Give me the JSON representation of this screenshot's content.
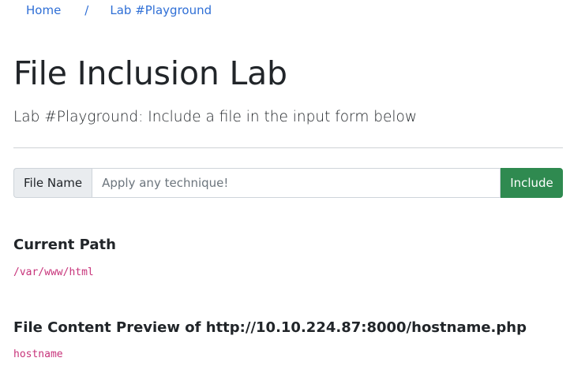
{
  "breadcrumb": {
    "home": "Home",
    "separator": "/",
    "current": "Lab #Playground"
  },
  "page": {
    "title": "File Inclusion Lab",
    "subtitle": "Lab #Playground: Include a file in the input form below"
  },
  "form": {
    "label": "File Name",
    "placeholder": "Apply any technique!",
    "value": "",
    "button": "Include",
    "button_color": "#2f8a50"
  },
  "current_path": {
    "heading": "Current Path",
    "value": "/var/www/html"
  },
  "preview": {
    "heading_prefix": "File Content Preview of",
    "url": "http://10.10.224.87:8000/hostname.php",
    "content": "hostname"
  },
  "colors": {
    "link": "#2f6fd6",
    "code": "#c7337a"
  }
}
